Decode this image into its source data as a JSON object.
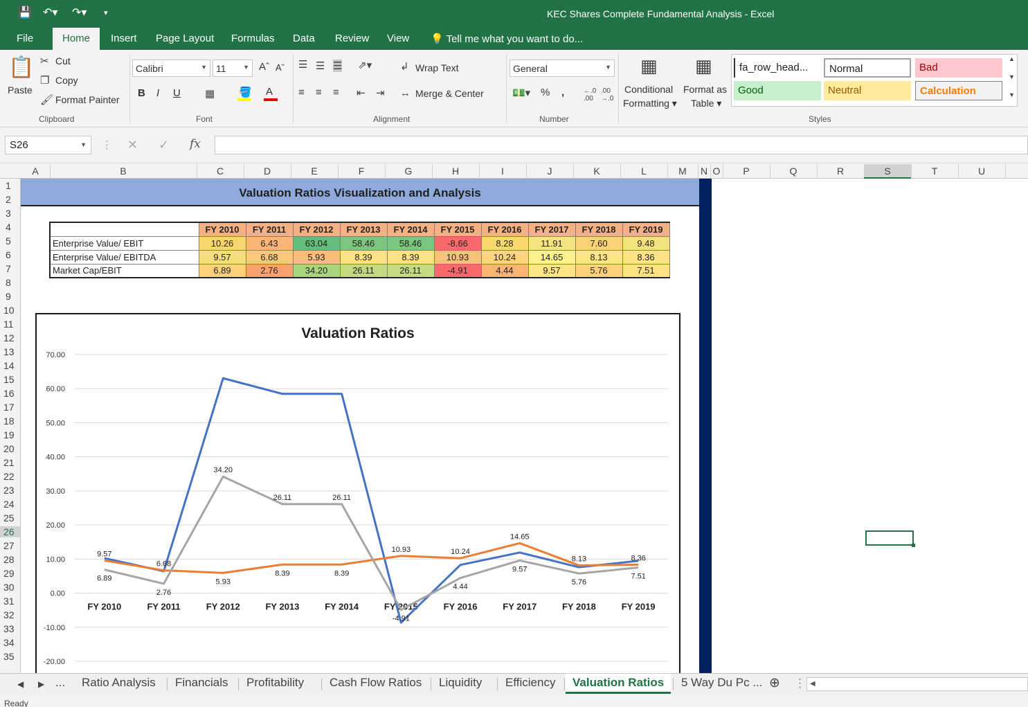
{
  "window": {
    "title": "KEC Shares Complete Fundamental Analysis - Excel"
  },
  "ribbon_tabs": [
    {
      "label": "File"
    },
    {
      "label": "Home"
    },
    {
      "label": "Insert"
    },
    {
      "label": "Page Layout"
    },
    {
      "label": "Formulas"
    },
    {
      "label": "Data"
    },
    {
      "label": "Review"
    },
    {
      "label": "View"
    }
  ],
  "tell_me": "Tell me what you want to do...",
  "clipboard": {
    "paste": "Paste",
    "cut": "Cut",
    "copy": "Copy",
    "format_painter": "Format Painter",
    "group": "Clipboard"
  },
  "font": {
    "name": "Calibri",
    "size": "11",
    "group": "Font",
    "bold": "B",
    "italic": "I",
    "underline": "U"
  },
  "alignment": {
    "wrap": "Wrap Text",
    "merge": "Merge & Center",
    "group": "Alignment"
  },
  "number": {
    "format": "General",
    "group": "Number",
    "percent": "%",
    "comma": ","
  },
  "styles_group": {
    "conditional": "Conditional",
    "conditional2": "Formatting",
    "format_as": "Format as",
    "format_as2": "Table",
    "group": "Styles",
    "cells": {
      "c1": "fa_row_head...",
      "c2": "Normal",
      "c3": "Bad",
      "c4": "Good",
      "c5": "Neutral",
      "c6": "Calculation"
    }
  },
  "formula_bar": {
    "name_box": "S26",
    "fx": "fx",
    "content": ""
  },
  "columns": [
    "A",
    "B",
    "C",
    "D",
    "E",
    "F",
    "G",
    "H",
    "I",
    "J",
    "K",
    "L",
    "M",
    "N",
    "O",
    "P",
    "Q",
    "R",
    "S",
    "T",
    "U"
  ],
  "rows": [
    "1",
    "2",
    "3",
    "4",
    "5",
    "6",
    "7",
    "8",
    "9",
    "10",
    "11",
    "12",
    "13",
    "14",
    "15",
    "16",
    "17",
    "18",
    "19",
    "20",
    "21",
    "22",
    "23",
    "24",
    "25",
    "26",
    "27",
    "28",
    "29",
    "30",
    "31",
    "32",
    "33",
    "34",
    "35"
  ],
  "banner": "Valuation Ratios Visualization and Analysis",
  "table": {
    "years": [
      "FY 2010",
      "FY 2011",
      "FY 2012",
      "FY 2013",
      "FY 2014",
      "FY 2015",
      "FY 2016",
      "FY 2017",
      "FY 2018",
      "FY 2019"
    ],
    "rows": [
      {
        "label": "Enterprise Value/ EBIT",
        "values": [
          "10.26",
          "6.43",
          "63.04",
          "58.46",
          "58.46",
          "-8.66",
          "8.28",
          "11.91",
          "7.60",
          "9.48"
        ]
      },
      {
        "label": "Enterprise Value/ EBITDA",
        "values": [
          "9.57",
          "6.68",
          "5.93",
          "8.39",
          "8.39",
          "10.93",
          "10.24",
          "14.65",
          "8.13",
          "8.36"
        ]
      },
      {
        "label": "Market Cap/EBIT",
        "values": [
          "6.89",
          "2.76",
          "34.20",
          "26.11",
          "26.11",
          "-4.91",
          "4.44",
          "9.57",
          "5.76",
          "7.51"
        ]
      }
    ],
    "cell_colors": [
      [
        "#f8d66d",
        "#fbb377",
        "#63be7b",
        "#7bc67d",
        "#7bc67d",
        "#f8696b",
        "#f9d86e",
        "#f7e382",
        "#fbd273",
        "#f4e17e"
      ],
      [
        "#f6de7c",
        "#fbc97a",
        "#fbbd79",
        "#fee283",
        "#fee283",
        "#fbc079",
        "#fcd47c",
        "#fef08a",
        "#fde583",
        "#fde382"
      ],
      [
        "#fccf7a",
        "#fba06f",
        "#abd47f",
        "#c2da81",
        "#c2da81",
        "#f8696b",
        "#fbb474",
        "#fee583",
        "#fdd17a",
        "#fee282"
      ]
    ]
  },
  "chart_data": {
    "type": "line",
    "title": "Valuation Ratios",
    "categories": [
      "FY 2010",
      "FY 2011",
      "FY 2012",
      "FY 2013",
      "FY 2014",
      "FY 2015",
      "FY 2016",
      "FY 2017",
      "FY 2018",
      "FY 2019"
    ],
    "ylim": [
      -20,
      70
    ],
    "yticks": [
      "70.00",
      "60.00",
      "50.00",
      "40.00",
      "30.00",
      "20.00",
      "10.00",
      "0.00",
      "-10.00",
      "-20.00"
    ],
    "grid": true,
    "series": [
      {
        "values": [
          10.26,
          6.43,
          63.04,
          58.46,
          58.46,
          -8.66,
          8.28,
          11.91,
          7.6,
          9.48
        ],
        "color": "#4472c4",
        "labels": false
      },
      {
        "values": [
          9.57,
          6.68,
          5.93,
          8.39,
          8.39,
          10.93,
          10.24,
          14.65,
          8.13,
          8.36
        ],
        "color": "#ed7d31",
        "labels": true
      },
      {
        "values": [
          6.89,
          2.76,
          34.2,
          26.11,
          26.11,
          -4.91,
          4.44,
          9.57,
          5.76,
          7.51
        ],
        "color": "#a5a5a5",
        "labels": true
      }
    ]
  },
  "sheet_tabs": [
    "Ratio Analysis",
    "Financials",
    "Profitability",
    "Cash Flow Ratios",
    "Liquidity",
    "Efficiency",
    "Valuation Ratios",
    "5 Way Du Pc ..."
  ],
  "active_sheet": "Valuation Ratios",
  "status": "Ready"
}
